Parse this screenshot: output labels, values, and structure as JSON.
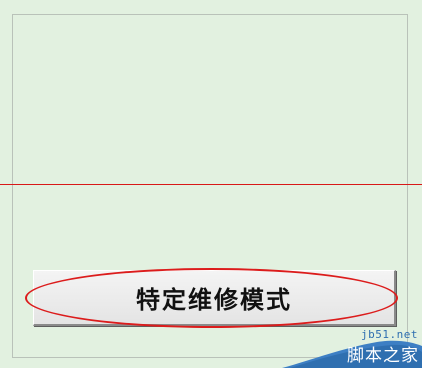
{
  "main": {
    "mode_button_label": "特定维修模式"
  },
  "watermark": {
    "domain": "jb51.net",
    "brand": "脚本之家"
  },
  "colors": {
    "background": "#e2f1e0",
    "highlight": "#dc1c1c",
    "guideline": "#d81818",
    "watermark_blue": "#2f6fb0"
  }
}
